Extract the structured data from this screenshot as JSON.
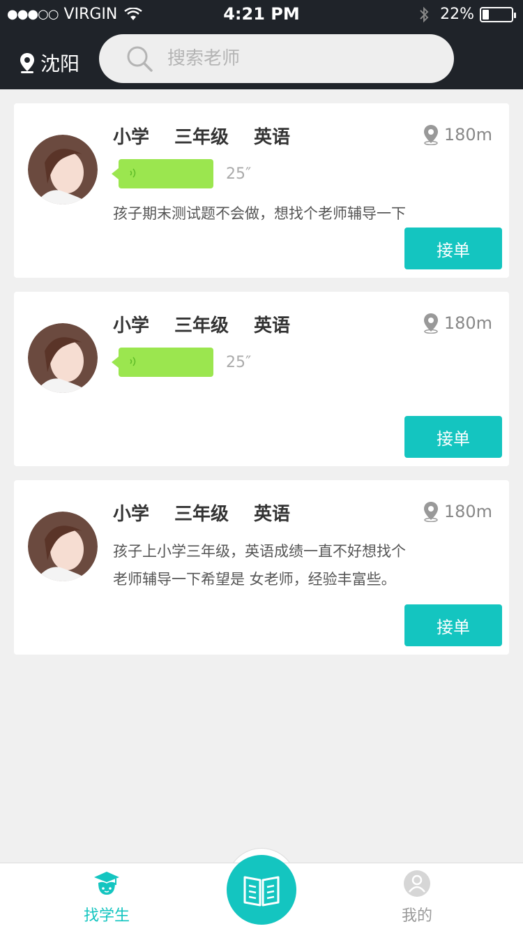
{
  "status_bar": {
    "signal": "●●●○○",
    "carrier": "VIRGIN",
    "time": "4:21 PM",
    "battery": "22%",
    "battery_level": 0.22
  },
  "header": {
    "city": "沈阳",
    "search": {
      "placeholder": "搜索老师",
      "value": ""
    }
  },
  "cards": [
    {
      "level": "小学",
      "grade": "三年级",
      "subject": "英语",
      "distance": "180m",
      "voice_duration": "25″",
      "description": "孩子期末测试题不会做，想找个老师辅导一下",
      "action": "接单"
    },
    {
      "level": "小学",
      "grade": "三年级",
      "subject": "英语",
      "distance": "180m",
      "voice_duration": "25″",
      "action": "接单"
    },
    {
      "level": "小学",
      "grade": "三年级",
      "subject": "英语",
      "distance": "180m",
      "description_lines": [
        "孩子上小学三年级，英语成绩一直不好想找个",
        "老师辅导一下希望是 女老师，经验丰富些。"
      ],
      "action": "接单"
    }
  ],
  "tabbar": {
    "students": "找学生",
    "mine": "我的"
  },
  "colors": {
    "accent": "#14c5c0",
    "header_bg": "#1f2329",
    "voice_bubble": "#9be64f"
  }
}
